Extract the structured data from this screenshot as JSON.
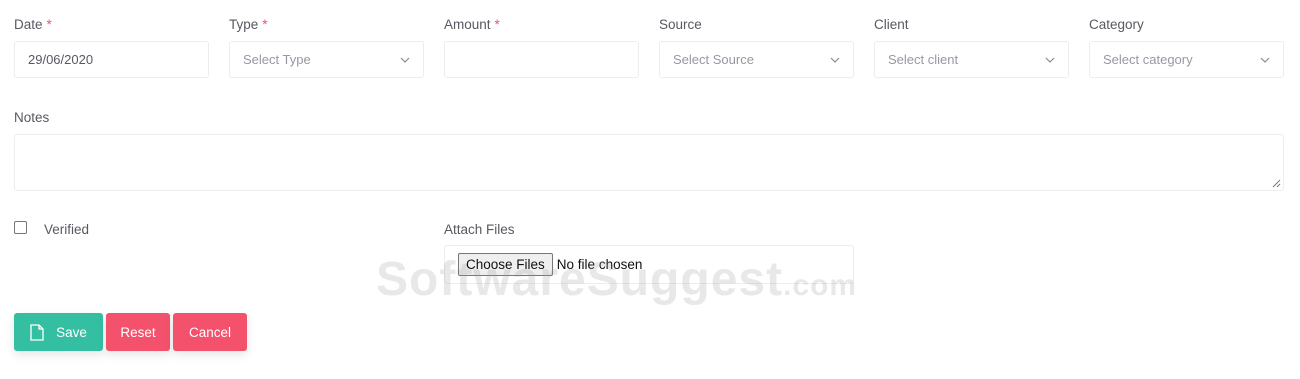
{
  "form": {
    "date": {
      "label": "Date",
      "required_mark": "*",
      "value": "29/06/2020"
    },
    "type": {
      "label": "Type",
      "required_mark": "*",
      "placeholder": "Select Type"
    },
    "amount": {
      "label": "Amount",
      "required_mark": "*",
      "value": ""
    },
    "source": {
      "label": "Source",
      "placeholder": "Select Source"
    },
    "client": {
      "label": "Client",
      "placeholder": "Select client"
    },
    "category": {
      "label": "Category",
      "placeholder": "Select category"
    },
    "notes": {
      "label": "Notes",
      "value": ""
    },
    "verified": {
      "label": "Verified",
      "checked": false
    },
    "attach": {
      "label": "Attach Files",
      "button_label": "Choose Files",
      "status": "No file chosen"
    }
  },
  "actions": {
    "save_label": "Save",
    "reset_label": "Reset",
    "cancel_label": "Cancel"
  },
  "watermark": {
    "text": "SoftwareSuggest",
    "suffix": ".com"
  },
  "colors": {
    "save": "#34bfa3",
    "danger": "#f4516c",
    "required": "#f4516c",
    "border": "#ebedf2"
  }
}
